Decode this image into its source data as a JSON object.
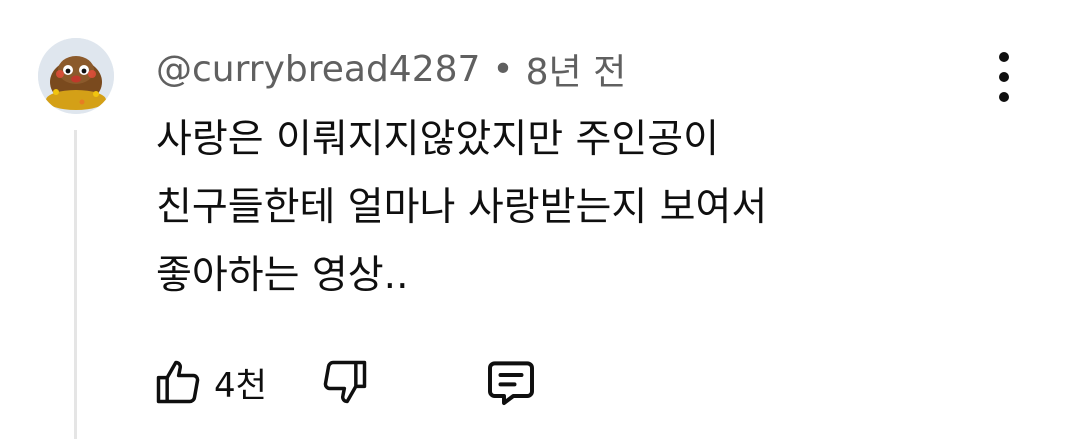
{
  "comment": {
    "author": "@currybread4287",
    "separator": "•",
    "time_ago": "8년 전",
    "lines": [
      "사랑은 이뤄지지않았지만 주인공이",
      "친구들한테 얼마나 사랑받는지 보여서",
      "좋아하는 영상.."
    ],
    "like_count": "4천"
  },
  "icons": {
    "avatar": "cartoon-character-avatar",
    "more": "more-vert-icon",
    "like": "thumbs-up-icon",
    "dislike": "thumbs-down-icon",
    "reply": "comment-reply-icon"
  },
  "colors": {
    "text": "#0f0f0f",
    "meta": "#606060",
    "thread_line": "#e5e5e5"
  }
}
